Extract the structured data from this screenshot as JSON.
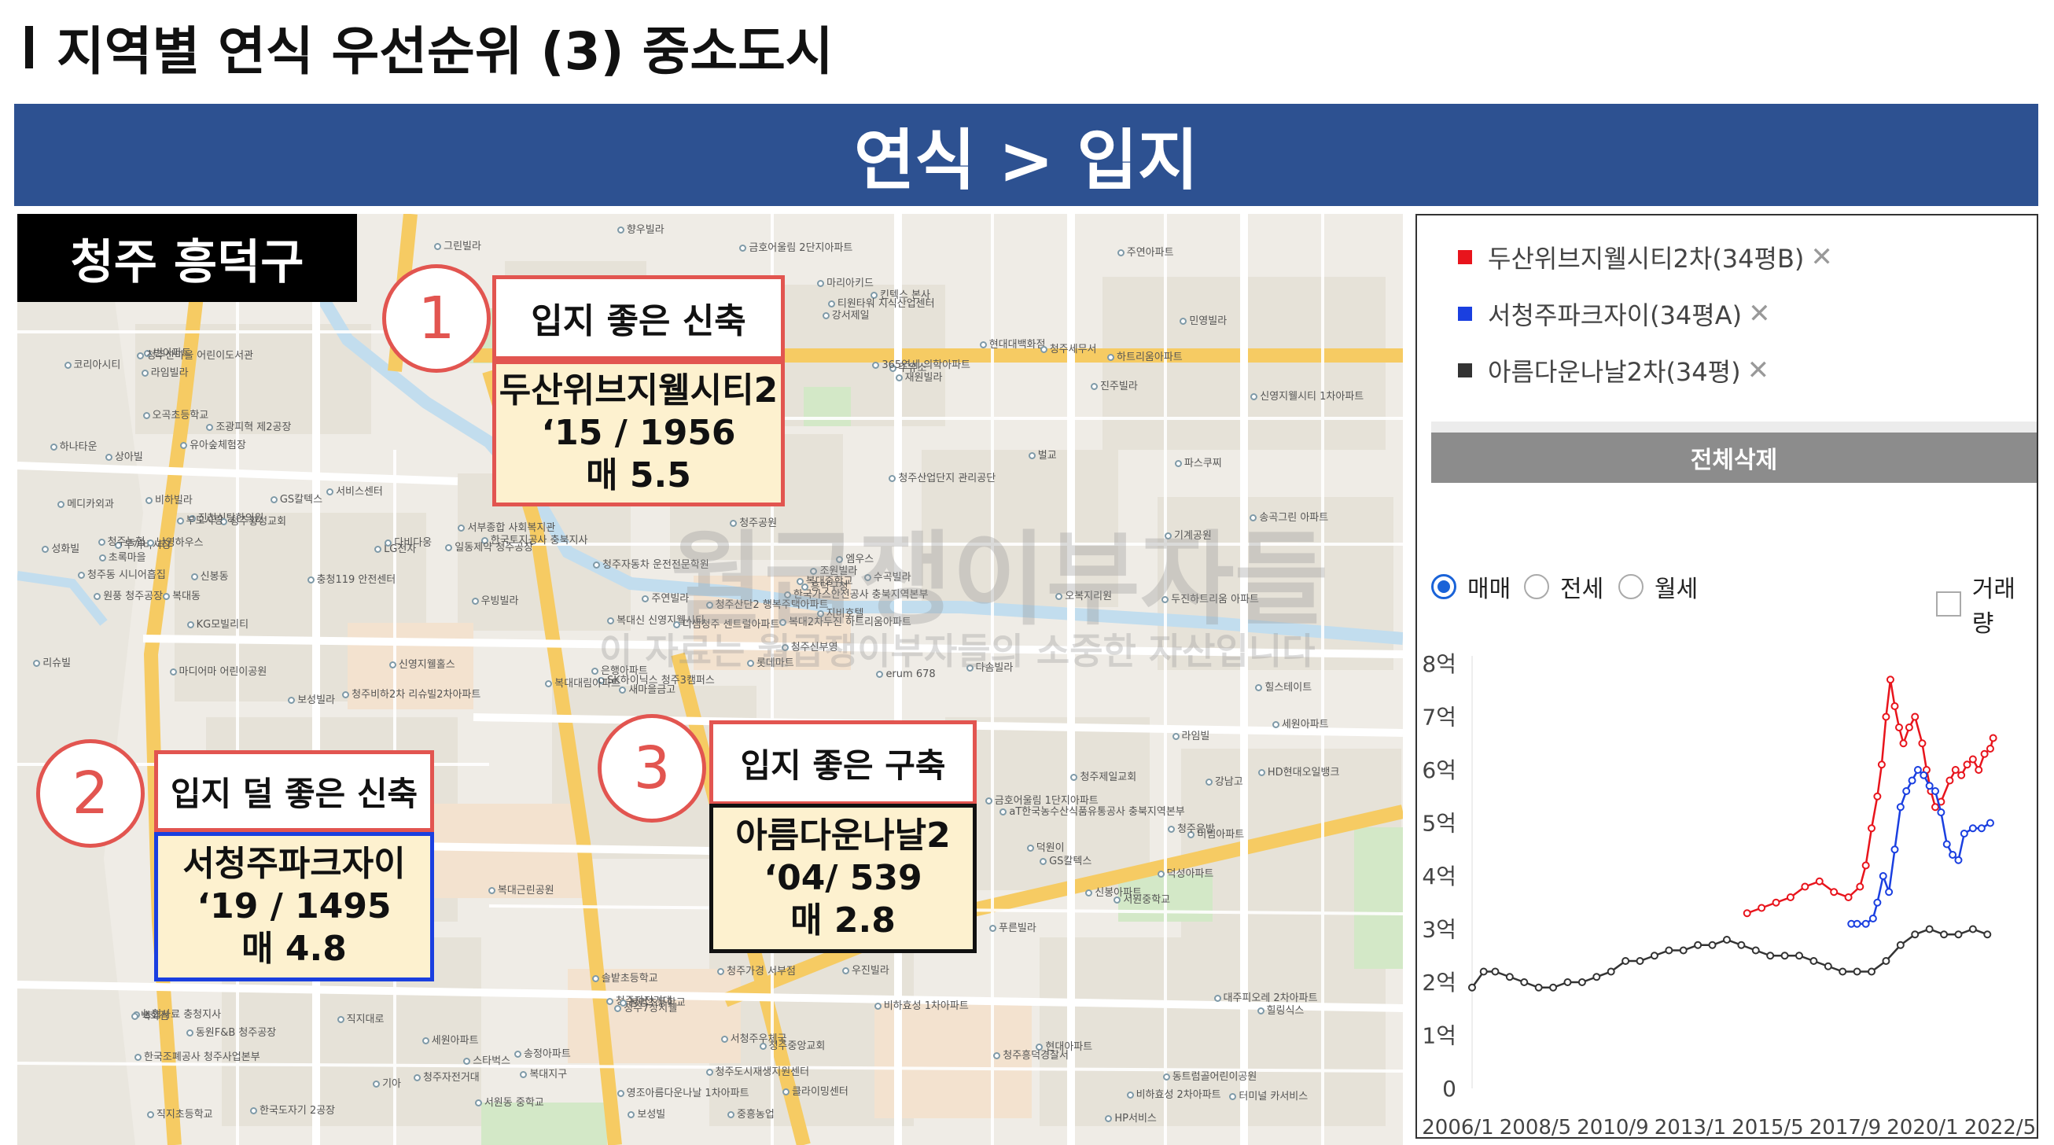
{
  "page": {
    "title": "지역별 연식 우선순위 (3) 중소도시",
    "banner": "연식 > 입지"
  },
  "map": {
    "district_label": "청주 흥덕구",
    "watermark_main": "월급쟁이부자들",
    "watermark_sub": "이 자료는 월급쟁이부자들의 소중한 자산입니다",
    "pois": [
      "유아숲체험장",
      "SK하이닉스 청주3캠퍼스",
      "농협사료 충청지사",
      "한국가스안전공사 충북지역본부",
      "킨텍스 본사",
      "주유소",
      "롯데마트",
      "터미널 카서비스",
      "KG모빌리티",
      "신영지웰시티 1차아파트",
      "청주산업단지 관리공단",
      "한국도자기 2공장",
      "청주공원",
      "한국토지공사 충북지사",
      "한국조폐공사 청주사업본부",
      "직지대로",
      "흥덕구청",
      "aT한국농수산식품유통공사 충북지역본부",
      "조광피혁 제2공장",
      "원풍 청주공장",
      "송곡그린 아파트",
      "은행아파트",
      "솔밭초등학교",
      "복대신 신영지웰시티",
      "현대대백화점",
      "비하효성 2차아파트",
      "대주피오레 2차아파트",
      "금호어울림 1단지아파트",
      "금호어울림 2단지아파트",
      "일동제약 청주공장",
      "충청119 안전센터",
      "기아",
      "성화빌",
      "복대2차두진 하트리움아파트",
      "직지초등학교",
      "청주7상지웰",
      "청주신부영",
      "파스쿠찌",
      "코리아시티",
      "비하효성 1차아파트",
      "청주가경 서부점",
      "하트리움아파트",
      "신영지웰홀스",
      "두꺼비시장",
      "서비스센터",
      "청주세무서",
      "티원타워 지식산업센터",
      "주연빌라",
      "스타벅스",
      "LG전자",
      "백화점",
      "GS칼텍스",
      "청주자동차 운전전문학원",
      "서청주우체국",
      "청주산단2 행복주택아파트",
      "동원F&B 청주공장",
      "erum 678",
      "미림아파트",
      "영조아름다운나날 1차아파트",
      "두진하트리움 아파트",
      "현대아파트",
      "중흥농업",
      "우진빌라",
      "세원아파트",
      "수곡빌라",
      "푸른빌라",
      "디샘청주 센트럴아파트",
      "덕성아파트",
      "초록마을",
      "보성빌",
      "365연세 의학아파트",
      "재원빌라",
      "보성빌라",
      "그린빌라",
      "힐스테이트",
      "청주동 시니어흡집",
      "세원아파트",
      "복대중학교",
      "진주빌라",
      "우빙빌라",
      "라임빌",
      "라임빌라",
      "복대대림아파트",
      "민영빌라",
      "주연아파트",
      "다솜빌라",
      "동트럼골어린이공원",
      "복대지구",
      "오복지리원",
      "오곡초등학교",
      "클라이밍센터",
      "다비다웅",
      "강남고",
      "GS칼텍스",
      "HD현대오일뱅크",
      "서부종합 사회복지관",
      "신봉동",
      "신봉아파트",
      "조원빌라",
      "번아파트",
      "송정아파트",
      "청주흥덕경찰서",
      "청주자전거대",
      "기계공원",
      "청주농협",
      "서원동 중학교",
      "청주제일교회",
      "청주비하2차 리슈빌2차아파트",
      "리슈빌",
      "향우빌라",
      "강서제일",
      "비하빌라",
      "힐링식스",
      "HP서비스",
      "서원중학교",
      "청주중앙교회",
      "메디카외과",
      "마리아키드",
      "엠우스",
      "청주자전거대",
      "하나타운",
      "진천식탕한의원",
      "상아빌",
      "청주도시재생지원센터",
      "남영하우스",
      "청주산마을 어린이도서관",
      "청주황성교회",
      "부모사랑",
      "복대동",
      "새마을금고",
      "청주은방",
      "복대근린공원",
      "벌교",
      "지비호텔",
      "봉명초등학교",
      "마디어마 어린이공원",
      "덕원이"
    ]
  },
  "callouts": [
    {
      "num": "1",
      "label": "입지 좋은 신축",
      "name": "두산위브지웰시티2",
      "stats": "‘15 / 1956",
      "price": "매 5.5"
    },
    {
      "num": "2",
      "label": "입지 덜 좋은 신축",
      "name": "서청주파크자이",
      "stats": "‘19 / 1495",
      "price": "매 4.8"
    },
    {
      "num": "3",
      "label": "입지 좋은 구축",
      "name": "아름다운나날2",
      "stats": "‘04/ 539",
      "price": "매 2.8"
    }
  ],
  "panel": {
    "legend": [
      {
        "label": "두산위브지웰시티2차(34평B)",
        "color": "#e8141c"
      },
      {
        "label": "서청주파크자이(34평A)",
        "color": "#1a3fe0"
      },
      {
        "label": "아름다운나날2차(34평)",
        "color": "#333333"
      }
    ],
    "remove_glyph": "✕",
    "delete_all": "전체삭제",
    "radios": [
      {
        "label": "매매",
        "selected": true
      },
      {
        "label": "전세",
        "selected": false
      },
      {
        "label": "월세",
        "selected": false
      }
    ],
    "checkbox_label": "거래량"
  },
  "chart_data": {
    "type": "line",
    "title": "",
    "xlabel": "",
    "ylabel": "",
    "y_ticks": [
      "0",
      "1억",
      "2억",
      "3억",
      "4억",
      "5억",
      "6억",
      "7억",
      "8억"
    ],
    "x_ticks": [
      "2006/1",
      "2008/5",
      "2010/9",
      "2013/1",
      "2015/5",
      "2017/9",
      "2020/1",
      "2022/5"
    ],
    "ylim": [
      0,
      8
    ],
    "xlim": [
      2006.0,
      2024.2
    ],
    "series": [
      {
        "name": "두산위브지웰시티2차(34평B)",
        "color": "#e8141c",
        "x": [
          2015.5,
          2016.0,
          2016.5,
          2017.0,
          2017.5,
          2018.0,
          2018.5,
          2019.0,
          2019.4,
          2019.6,
          2019.8,
          2020.0,
          2020.15,
          2020.3,
          2020.45,
          2020.6,
          2020.75,
          2020.9,
          2021.1,
          2021.3,
          2021.55,
          2021.7,
          2021.85,
          2022.0,
          2022.2,
          2022.5,
          2022.7,
          2022.9,
          2023.1,
          2023.3,
          2023.5,
          2023.7,
          2023.9,
          2024.0
        ],
        "y": [
          3.3,
          3.4,
          3.5,
          3.6,
          3.8,
          3.9,
          3.7,
          3.6,
          3.8,
          4.2,
          4.9,
          5.5,
          6.1,
          7.0,
          7.7,
          7.2,
          6.8,
          6.5,
          6.8,
          7.0,
          6.5,
          6.0,
          5.6,
          5.3,
          5.4,
          5.8,
          6.0,
          5.9,
          6.1,
          6.2,
          6.0,
          6.3,
          6.4,
          6.6
        ]
      },
      {
        "name": "서청주파크자이(34평A)",
        "color": "#1a3fe0",
        "x": [
          2019.1,
          2019.3,
          2019.6,
          2019.85,
          2020.0,
          2020.2,
          2020.4,
          2020.6,
          2020.8,
          2021.0,
          2021.2,
          2021.4,
          2021.6,
          2021.8,
          2022.0,
          2022.2,
          2022.4,
          2022.6,
          2022.8,
          2023.0,
          2023.3,
          2023.6,
          2023.9
        ],
        "y": [
          3.1,
          3.1,
          3.1,
          3.2,
          3.5,
          4.0,
          3.7,
          4.5,
          5.3,
          5.6,
          5.8,
          6.0,
          5.9,
          5.7,
          5.6,
          5.2,
          4.6,
          4.4,
          4.3,
          4.8,
          4.9,
          4.9,
          5.0
        ]
      },
      {
        "name": "아름다운나날2차(34평)",
        "color": "#333333",
        "x": [
          2006.0,
          2006.4,
          2006.8,
          2007.3,
          2007.8,
          2008.3,
          2008.8,
          2009.3,
          2009.8,
          2010.3,
          2010.8,
          2011.3,
          2011.8,
          2012.3,
          2012.8,
          2013.3,
          2013.8,
          2014.3,
          2014.8,
          2015.3,
          2015.8,
          2016.3,
          2016.8,
          2017.3,
          2017.8,
          2018.3,
          2018.8,
          2019.3,
          2019.8,
          2020.3,
          2020.8,
          2021.3,
          2021.8,
          2022.3,
          2022.8,
          2023.3,
          2023.8
        ],
        "y": [
          1.9,
          2.2,
          2.2,
          2.1,
          2.0,
          1.9,
          1.9,
          2.0,
          2.0,
          2.1,
          2.2,
          2.4,
          2.4,
          2.5,
          2.6,
          2.6,
          2.7,
          2.7,
          2.8,
          2.7,
          2.6,
          2.5,
          2.5,
          2.5,
          2.4,
          2.3,
          2.2,
          2.2,
          2.2,
          2.4,
          2.7,
          2.9,
          3.0,
          2.9,
          2.9,
          3.0,
          2.9
        ]
      }
    ]
  }
}
